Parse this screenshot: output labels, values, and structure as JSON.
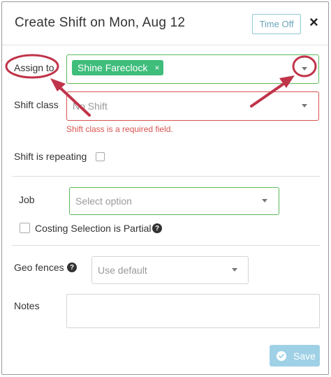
{
  "header": {
    "title": "Create Shift on Mon, Aug 12",
    "time_off_label": "Time Off",
    "close_glyph": "×"
  },
  "assign_to": {
    "label": "Assign to",
    "selected_tag": "Shine Fareclock",
    "tag_remove_glyph": "×"
  },
  "shift_class": {
    "label": "Shift class",
    "placeholder": "No Shift",
    "error": "Shift class is a required field."
  },
  "shift_repeating": {
    "label": "Shift is repeating",
    "checked": false
  },
  "job": {
    "label": "Job",
    "placeholder": "Select option"
  },
  "costing": {
    "label": "Costing Selection is Partial",
    "checked": false,
    "help_glyph": "?"
  },
  "geo_fences": {
    "label": "Geo fences",
    "help_glyph": "?",
    "value": "Use default"
  },
  "notes": {
    "label": "Notes",
    "value": ""
  },
  "footer": {
    "save_label": "Save"
  },
  "colors": {
    "accent_green": "#3ebd7b",
    "error_red": "#d9534f",
    "annotation": "#c0344a",
    "save_blue": "#9fd1e6"
  }
}
